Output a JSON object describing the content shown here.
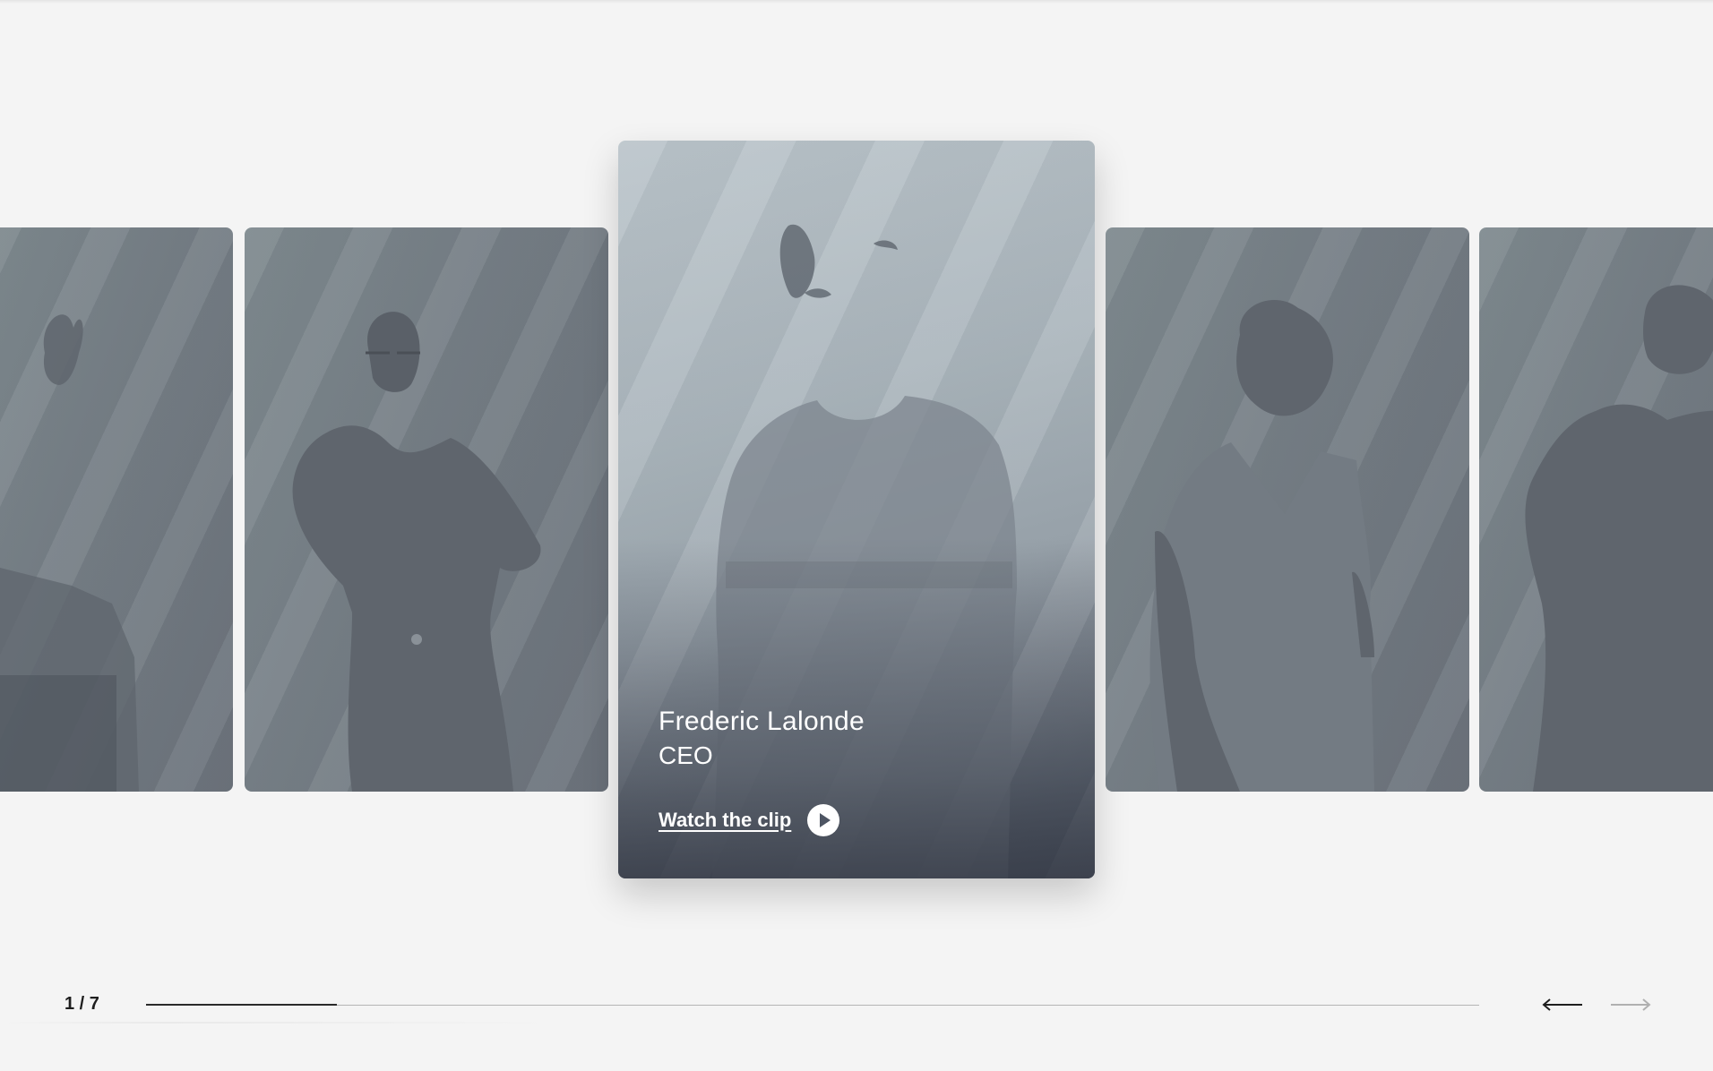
{
  "carousel": {
    "active_person": {
      "name": "Frederic Lalonde",
      "role": "CEO",
      "cta_label": "Watch the clip"
    },
    "counter": "1 / 7",
    "progress_fraction": 0.143,
    "icons": {
      "play": "play-icon",
      "prev": "arrow-left-icon",
      "next": "arrow-right-icon"
    },
    "colors": {
      "background": "#f4f4f4",
      "card": "#778087",
      "silhouette": "#5f656d",
      "progress_fill": "#2a2a2a",
      "progress_track": "#b5b5b5",
      "nav_active": "#1e1e1e",
      "nav_disabled": "#b0b0b0"
    }
  }
}
